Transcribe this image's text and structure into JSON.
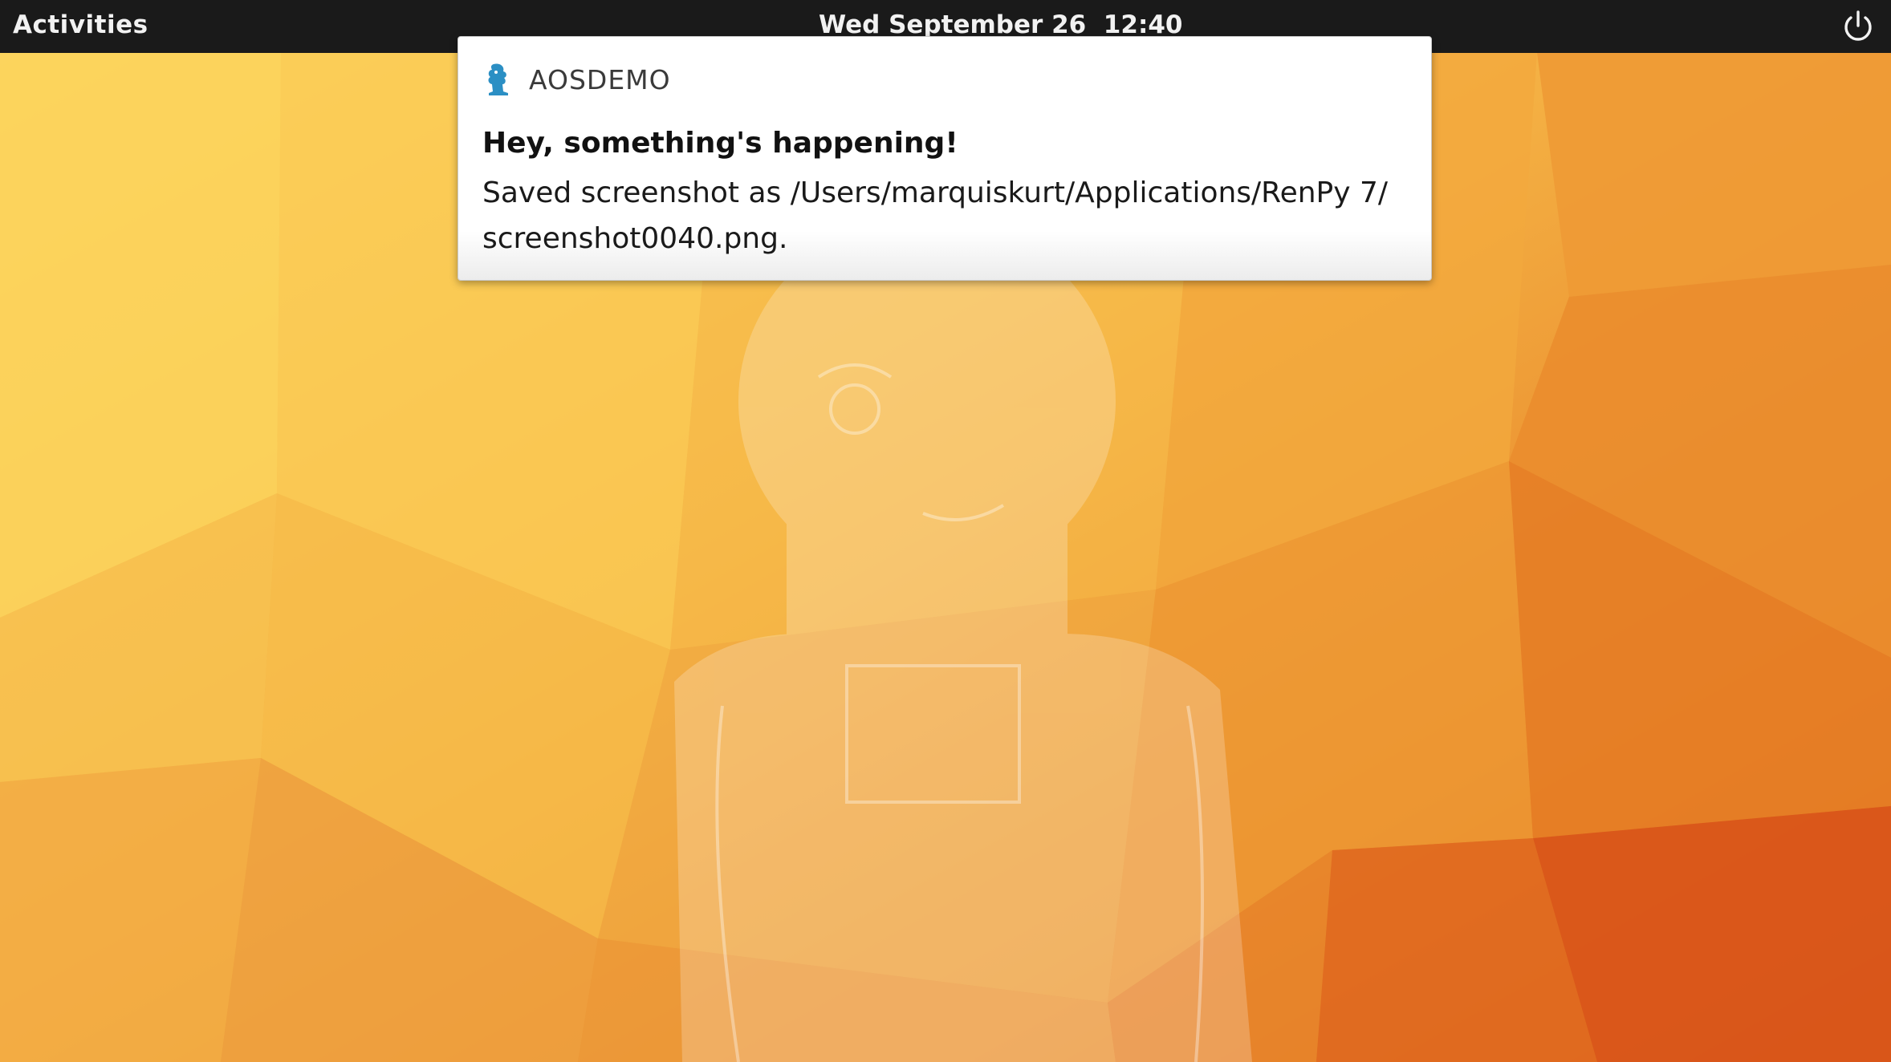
{
  "topbar": {
    "activities_label": "Activities",
    "clock_text": "Wed September 26  12:40",
    "power_icon": "power-icon"
  },
  "notification": {
    "app_name": "AOSDEMO",
    "app_icon": "renpy-app-icon",
    "title": "Hey, something's happening!",
    "body_line1": "Saved screenshot as /Users/marquiskurt/Applications/RenPy 7/",
    "body_line2": "screenshot0040.png."
  },
  "colors": {
    "topbar_bg": "#1a1a1a",
    "wallpaper_light": "#fcd460",
    "wallpaper_mid": "#f0a63c",
    "wallpaper_dark": "#d9540e",
    "app_icon_color": "#2b8fc4"
  }
}
